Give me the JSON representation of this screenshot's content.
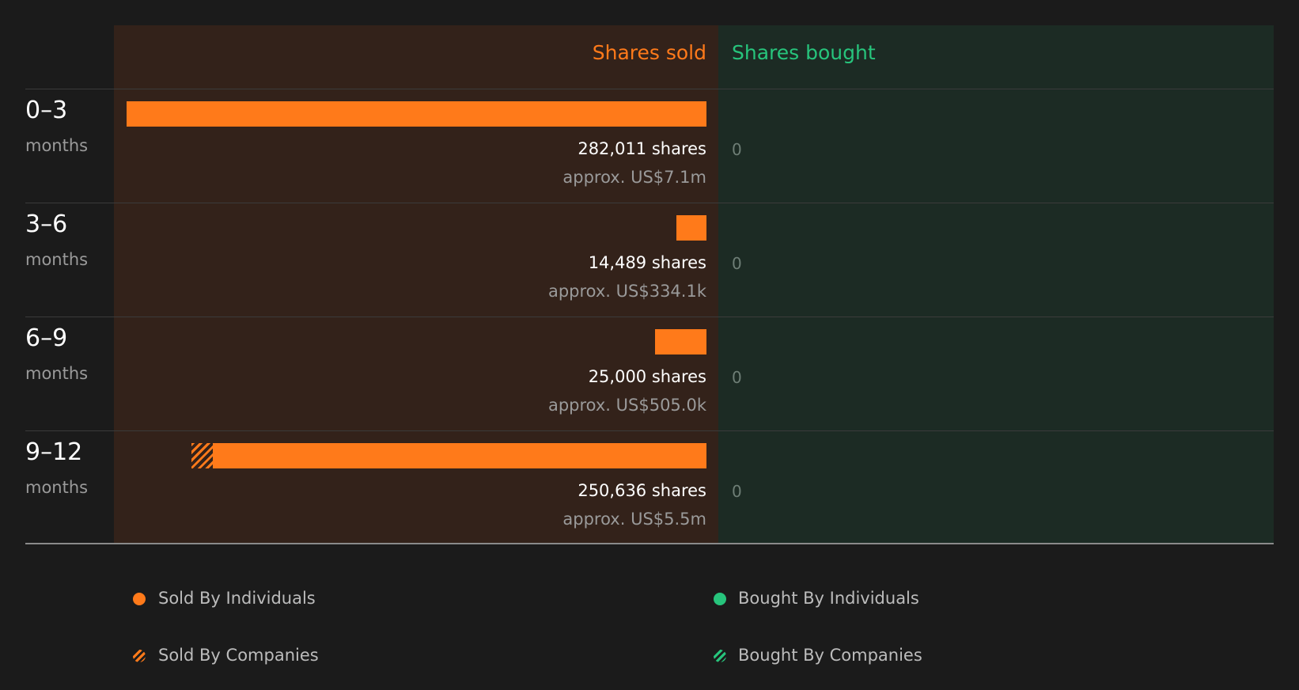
{
  "chart_data": {
    "type": "bar",
    "headers": {
      "sold": "Shares sold",
      "bought": "Shares bought"
    },
    "categories": [
      {
        "period": "0–3",
        "unit": "months"
      },
      {
        "period": "3–6",
        "unit": "months"
      },
      {
        "period": "6–9",
        "unit": "months"
      },
      {
        "period": "9–12",
        "unit": "months"
      }
    ],
    "series": [
      {
        "name": "Sold By Individuals",
        "values": [
          282011,
          14489,
          25000,
          240000
        ]
      },
      {
        "name": "Sold By Companies",
        "values": [
          0,
          0,
          0,
          10636
        ]
      },
      {
        "name": "Bought By Individuals",
        "values": [
          0,
          0,
          0,
          0
        ]
      },
      {
        "name": "Bought By Companies",
        "values": [
          0,
          0,
          0,
          0
        ]
      }
    ],
    "rows": [
      {
        "shares_label": "282,011 shares",
        "approx_label": "approx. US$7.1m",
        "bought_label": "0"
      },
      {
        "shares_label": "14,489 shares",
        "approx_label": "approx. US$334.1k",
        "bought_label": "0"
      },
      {
        "shares_label": "25,000 shares",
        "approx_label": "approx. US$505.0k",
        "bought_label": "0"
      },
      {
        "shares_label": "250,636 shares",
        "approx_label": "approx. US$5.5m",
        "bought_label": "0"
      }
    ],
    "legend": [
      {
        "label": "Sold By Individuals"
      },
      {
        "label": "Sold By Companies"
      },
      {
        "label": "Bought By Individuals"
      },
      {
        "label": "Bought By Companies"
      }
    ],
    "legend_placement": "bottom",
    "colors": {
      "sold": "#ff7a1a",
      "bought": "#27c47c",
      "background": "#1b1b1b"
    }
  }
}
